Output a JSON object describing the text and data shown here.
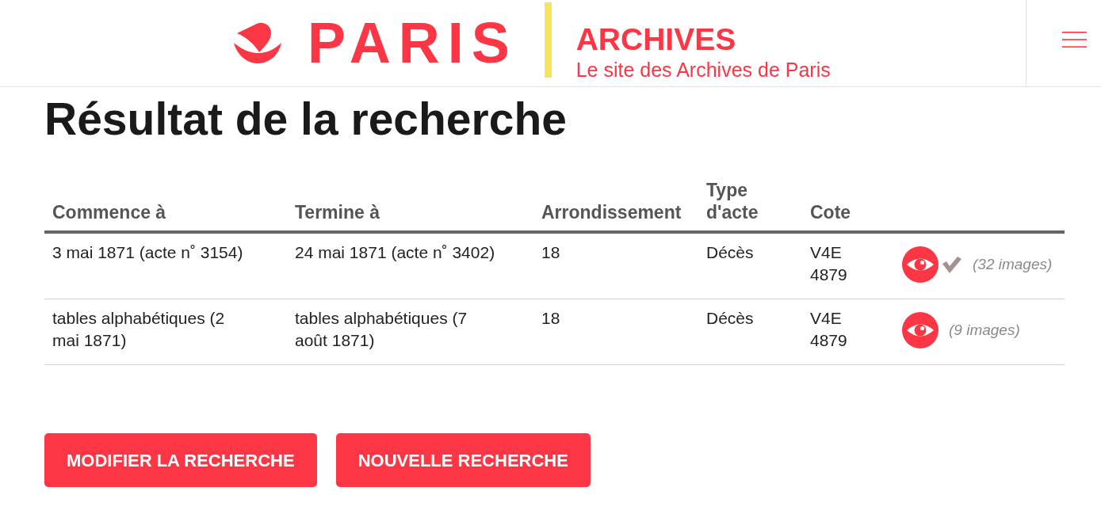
{
  "header": {
    "logo_text": "PARIS",
    "site_title": "ARCHIVES",
    "site_subtitle": "Le site des Archives de Paris"
  },
  "page_title": "Résultat de la recherche",
  "table": {
    "columns": [
      "Commence à",
      "Termine à",
      "Arrondissement",
      "Type d'acte",
      "Cote"
    ],
    "rows": [
      {
        "cells": [
          "3 mai 1871 (acte n˚ 3154)",
          "24 mai 1871 (acte n˚ 3402)",
          "18",
          "Décès",
          "V4E 4879"
        ],
        "viewed": true,
        "image_count": "(32 images)"
      },
      {
        "cells": [
          "tables alphabétiques (2 mai 1871)",
          "tables alphabétiques (7 août 1871)",
          "18",
          "Décès",
          "V4E 4879"
        ],
        "viewed": false,
        "image_count": "(9 images)"
      }
    ]
  },
  "buttons": [
    "MODIFIER LA RECHERCHE",
    "NOUVELLE RECHERCHE"
  ]
}
